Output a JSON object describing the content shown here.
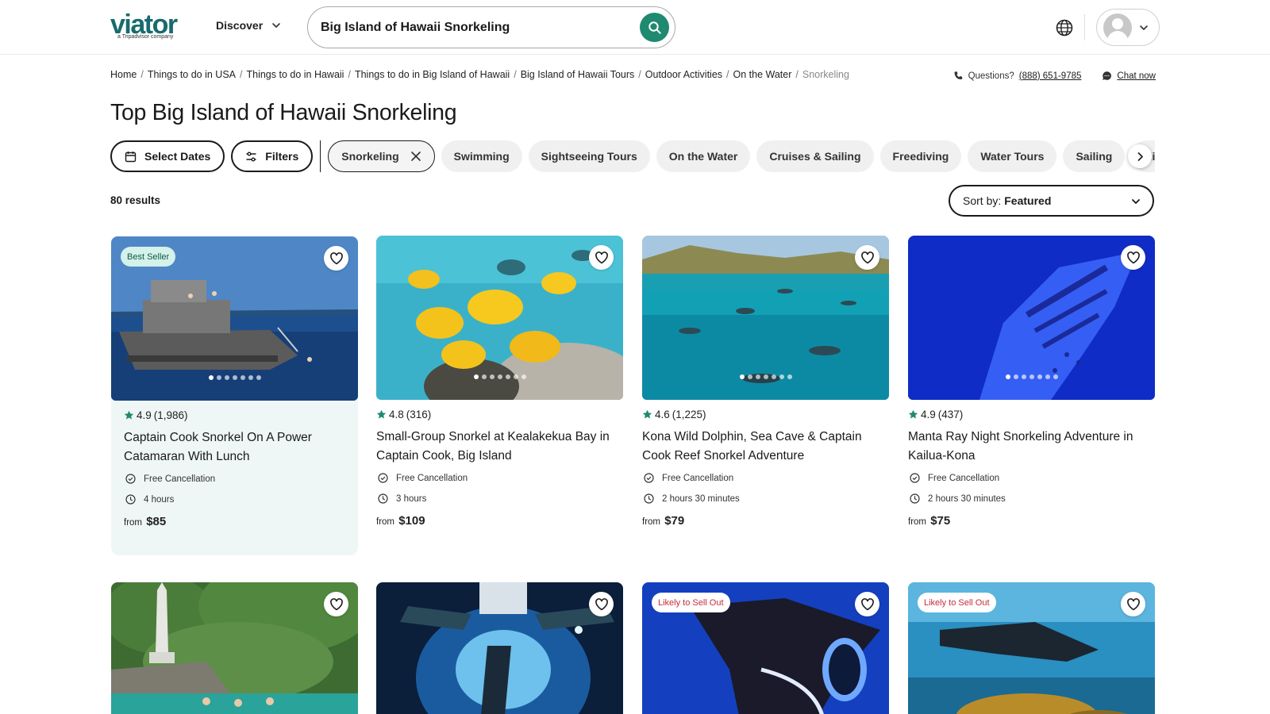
{
  "header": {
    "logo_text": "viator",
    "logo_sub": "a Tripadvisor company",
    "discover_label": "Discover",
    "search_value": "Big Island of Hawaii Snorkeling"
  },
  "breadcrumb": {
    "items": [
      "Home",
      "Things to do in USA",
      "Things to do in Hawaii",
      "Things to do in Big Island of Hawaii",
      "Big Island of Hawaii Tours",
      "Outdoor Activities",
      "On the Water"
    ],
    "current": "Snorkeling",
    "separator": "/"
  },
  "help": {
    "questions_label": "Questions?",
    "phone": "(888) 651-9785",
    "chat_label": "Chat now"
  },
  "page_title": "Top Big Island of Hawaii Snorkeling",
  "filters": {
    "select_dates": "Select Dates",
    "filters_label": "Filters",
    "active": "Snorkeling",
    "chips": [
      "Swimming",
      "Sightseeing Tours",
      "On the Water",
      "Cruises & Sailing",
      "Freediving",
      "Water Tours",
      "Sailing",
      "Hiking"
    ]
  },
  "results": {
    "count_text": "80 results",
    "sort_prefix": "Sort by:",
    "sort_value": "Featured"
  },
  "cards": [
    {
      "badge": "Best Seller",
      "rating": "4.9",
      "reviews": "(1,986)",
      "title": "Captain Cook Snorkel On A Power Catamaran With Lunch",
      "cancellation": "Free Cancellation",
      "duration": "4 hours",
      "from_label": "from",
      "price": "$85"
    },
    {
      "badge": "",
      "rating": "4.8",
      "reviews": "(316)",
      "title": "Small-Group Snorkel at Kealakekua Bay in Captain Cook, Big Island",
      "cancellation": "Free Cancellation",
      "duration": "3 hours",
      "from_label": "from",
      "price": "$109"
    },
    {
      "badge": "",
      "rating": "4.6",
      "reviews": "(1,225)",
      "title": "Kona Wild Dolphin, Sea Cave & Captain Cook Reef Snorkel Adventure",
      "cancellation": "Free Cancellation",
      "duration": "2 hours 30 minutes",
      "from_label": "from",
      "price": "$79"
    },
    {
      "badge": "",
      "rating": "4.9",
      "reviews": "(437)",
      "title": "Manta Ray Night Snorkeling Adventure in Kailua-Kona",
      "cancellation": "Free Cancellation",
      "duration": "2 hours 30 minutes",
      "from_label": "from",
      "price": "$75"
    },
    {
      "badge": ""
    },
    {
      "badge": ""
    },
    {
      "badge": "Likely to Sell Out"
    },
    {
      "badge": "Likely to Sell Out"
    }
  ],
  "icons": {
    "search": "search-icon",
    "globe": "globe-icon",
    "heart": "heart-icon",
    "star": "star-icon",
    "check": "check-circle-icon",
    "clock": "clock-icon",
    "calendar": "calendar-icon",
    "sliders": "sliders-icon",
    "phone": "phone-icon",
    "chat": "chat-icon"
  },
  "colors": {
    "brand": "#186b6d",
    "search_button": "#1f8a70",
    "star": "#1f8a70",
    "best_seller_bg": "#d4f1ea",
    "sell_out_text": "#c62c3b",
    "featured_card_bg": "#eef7f5"
  }
}
